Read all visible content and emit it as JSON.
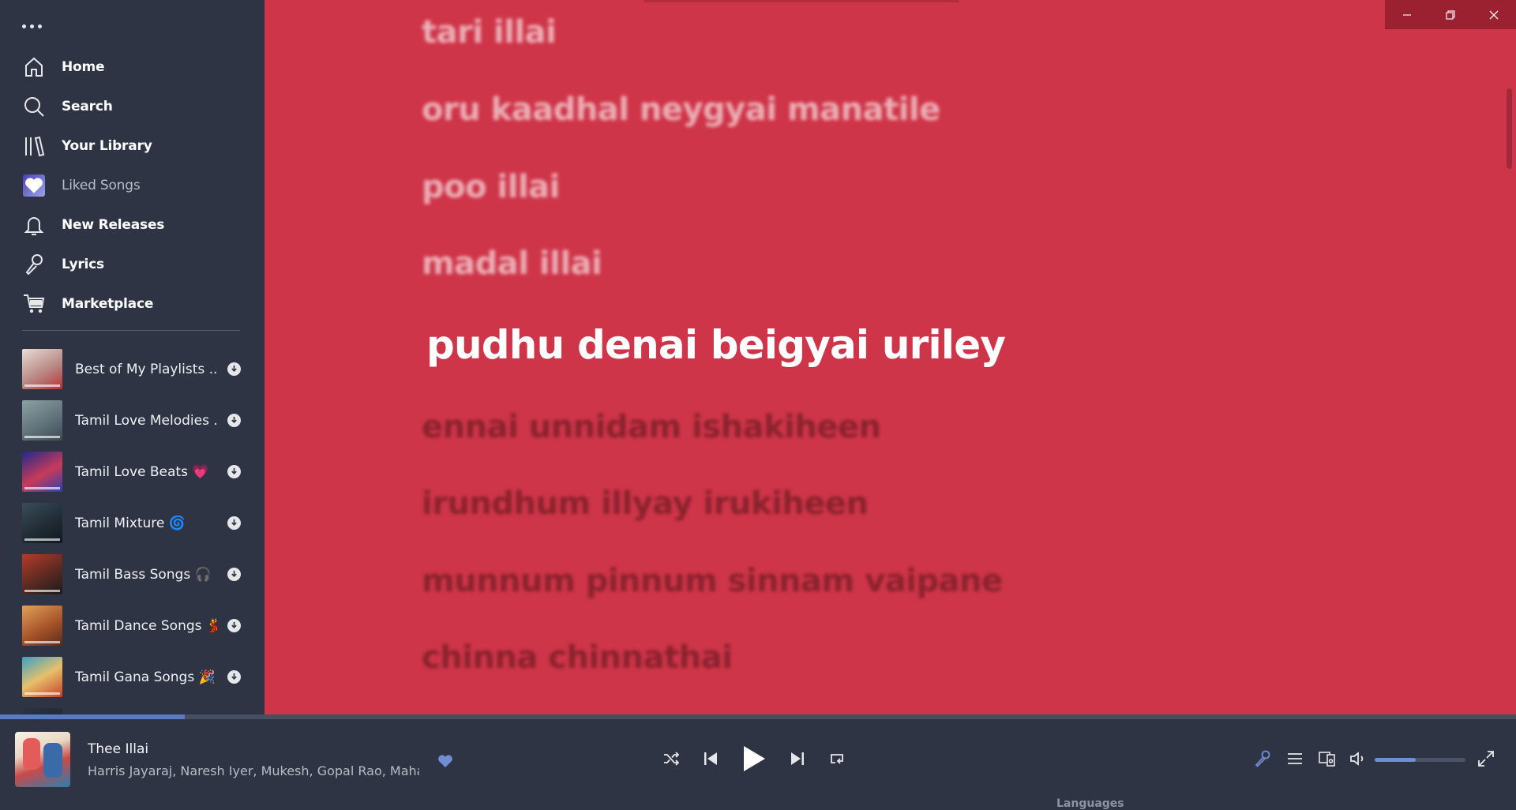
{
  "sidebar": {
    "nav": [
      {
        "label": "Home",
        "icon": "home-icon"
      },
      {
        "label": "Search",
        "icon": "search-icon"
      },
      {
        "label": "Your Library",
        "icon": "library-icon"
      },
      {
        "label": "Liked Songs",
        "icon": "heart-icon"
      },
      {
        "label": "New Releases",
        "icon": "bell-icon"
      },
      {
        "label": "Lyrics",
        "icon": "microphone-icon"
      },
      {
        "label": "Marketplace",
        "icon": "cart-icon"
      }
    ],
    "playlists": [
      {
        "name": "Best of My Playlists ...",
        "downloaded": true
      },
      {
        "name": "Tamil Love Melodies ...",
        "downloaded": true
      },
      {
        "name": "Tamil Love Beats 💗",
        "downloaded": true
      },
      {
        "name": "Tamil Mixture 🌀",
        "downloaded": true
      },
      {
        "name": "Tamil Bass Songs 🎧",
        "downloaded": true
      },
      {
        "name": "Tamil Dance Songs 💃",
        "downloaded": true
      },
      {
        "name": "Tamil Gana Songs 🎉",
        "downloaded": true
      }
    ]
  },
  "lyrics": {
    "lines": [
      "tari illai",
      "oru kaadhal neygyai manatile",
      "poo illai",
      "madal illai",
      "pudhu denai beigyai uriley",
      "ennai unnidam ishakiheen",
      "irundhum illyay irukiheen",
      "munnum pinnum sinnam vaipane",
      "chinna chinnathai"
    ],
    "current_index": 4,
    "background_color": "#cf3549"
  },
  "now_playing": {
    "title": "Thee Illai",
    "artists": "Harris Jayaraj, Naresh Iyer, Mukesh, Gopal Rao, Mahathi",
    "liked": true,
    "progress": 0.122,
    "volume": 0.45
  },
  "footer_peek": "Languages",
  "colors": {
    "accent": "#5b7bc0",
    "sidebar_bg": "#2e3443",
    "lyrics_bg": "#cf3549"
  }
}
